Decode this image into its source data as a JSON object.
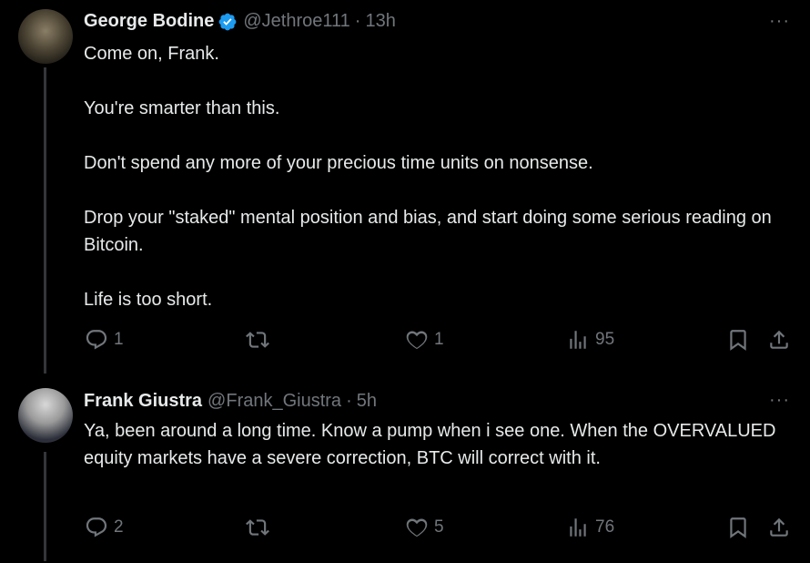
{
  "tweets": [
    {
      "author": {
        "name": "George Bodine",
        "handle": "@Jethroe111",
        "verified": true
      },
      "time": "13h",
      "paragraphs": [
        "Come on, Frank.",
        "You're smarter than this.",
        "Don't spend any more of your precious time units on nonsense.",
        "Drop your \"staked\" mental position and bias, and start doing some serious reading on Bitcoin.",
        "Life is too short."
      ],
      "stats": {
        "replies": "1",
        "reposts": "",
        "likes": "1",
        "views": "95"
      }
    },
    {
      "author": {
        "name": "Frank Giustra",
        "handle": "@Frank_Giustra",
        "verified": false
      },
      "time": "5h",
      "paragraphs": [
        "Ya,  been around a long time. Know a pump when i see one. When the OVERVALUED equity markets have a severe correction, BTC will correct with it."
      ],
      "stats": {
        "replies": "2",
        "reposts": "",
        "likes": "5",
        "views": "76"
      }
    }
  ],
  "ui": {
    "separator": "·",
    "more": "···"
  },
  "colors": {
    "background": "#000000",
    "text": "#e7e9ea",
    "muted": "#71767b",
    "verified": "#1d9bf0"
  }
}
